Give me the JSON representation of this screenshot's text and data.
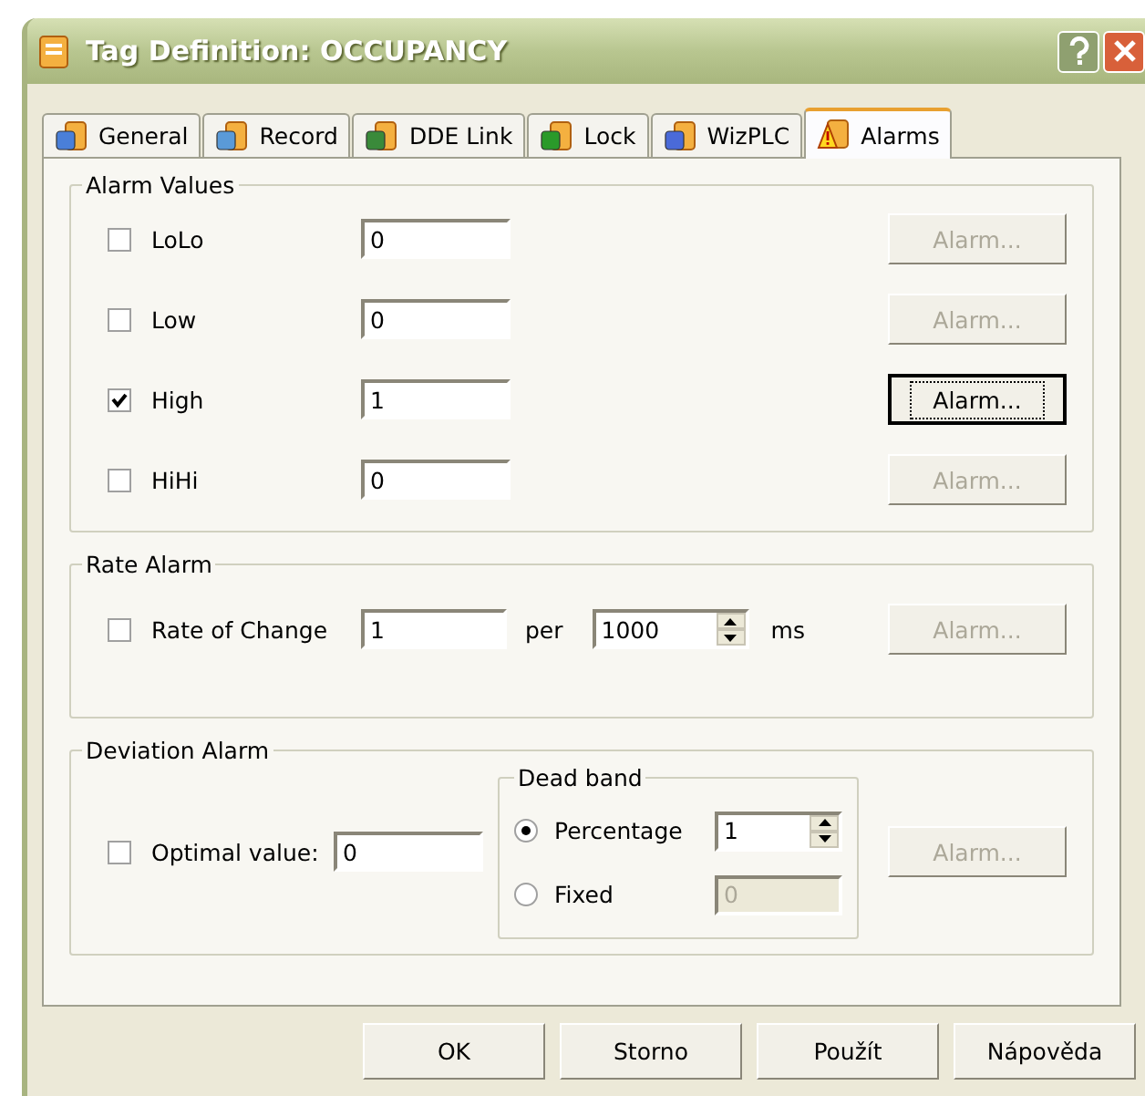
{
  "window": {
    "title": "Tag Definition: OCCUPANCY"
  },
  "tabs": [
    {
      "label": "General",
      "selected": false
    },
    {
      "label": "Record",
      "selected": false
    },
    {
      "label": "DDE Link",
      "selected": false
    },
    {
      "label": "Lock",
      "selected": false
    },
    {
      "label": "WizPLC",
      "selected": false
    },
    {
      "label": "Alarms",
      "selected": true
    }
  ],
  "alarm_values": {
    "title": "Alarm Values",
    "rows": [
      {
        "label": "LoLo",
        "checked": false,
        "value": "0",
        "button": {
          "label": "Alarm...",
          "disabled": true,
          "default": false
        }
      },
      {
        "label": "Low",
        "checked": false,
        "value": "0",
        "button": {
          "label": "Alarm...",
          "disabled": true,
          "default": false
        }
      },
      {
        "label": "High",
        "checked": true,
        "value": "1",
        "button": {
          "label": "Alarm...",
          "disabled": false,
          "default": true
        }
      },
      {
        "label": "HiHi",
        "checked": false,
        "value": "0",
        "button": {
          "label": "Alarm...",
          "disabled": true,
          "default": false
        }
      }
    ]
  },
  "rate_alarm": {
    "title": "Rate Alarm",
    "checked": false,
    "label": "Rate of Change",
    "value": "1",
    "per_label": "per",
    "interval": "1000",
    "unit": "ms",
    "button": {
      "label": "Alarm...",
      "disabled": true,
      "default": false
    }
  },
  "deviation_alarm": {
    "title": "Deviation Alarm",
    "checked": false,
    "label": "Optimal value:",
    "value": "0",
    "dead_band": {
      "title": "Dead band",
      "options": [
        {
          "label": "Percentage",
          "selected": true,
          "value": "1",
          "kind": "spinner",
          "disabled": false
        },
        {
          "label": "Fixed",
          "selected": false,
          "value": "0",
          "kind": "field",
          "disabled": true
        }
      ]
    },
    "button": {
      "label": "Alarm...",
      "disabled": true,
      "default": false
    }
  },
  "buttons": [
    {
      "label": "OK"
    },
    {
      "label": "Storno"
    },
    {
      "label": "Použít"
    },
    {
      "label": "Nápověda"
    }
  ]
}
